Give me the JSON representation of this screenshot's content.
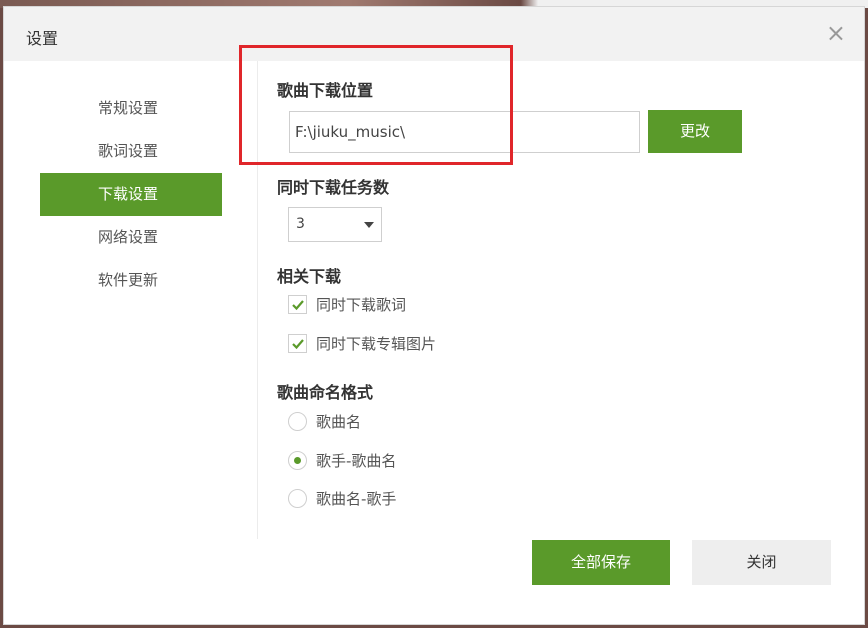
{
  "dialog": {
    "title": "设置",
    "close_icon": "close-icon",
    "close_glyph": "×"
  },
  "sidebar": {
    "items": [
      {
        "label": "常规设置",
        "active": false
      },
      {
        "label": "歌词设置",
        "active": false
      },
      {
        "label": "下载设置",
        "active": true
      },
      {
        "label": "网络设置",
        "active": false
      },
      {
        "label": "软件更新",
        "active": false
      }
    ]
  },
  "download_location": {
    "title": "歌曲下载位置",
    "path_value": "F:\\jiuku_music\\",
    "change_label": "更改"
  },
  "concurrent_tasks": {
    "title": "同时下载任务数",
    "selected": "3"
  },
  "related_downloads": {
    "title": "相关下载",
    "options": [
      {
        "label": "同时下载歌词",
        "checked": true
      },
      {
        "label": "同时下载专辑图片",
        "checked": true
      }
    ]
  },
  "naming_format": {
    "title": "歌曲命名格式",
    "options": [
      {
        "label": "歌曲名",
        "selected": false
      },
      {
        "label": "歌手-歌曲名",
        "selected": true
      },
      {
        "label": "歌曲名-歌手",
        "selected": false
      }
    ]
  },
  "footer": {
    "save_label": "全部保存",
    "close_label": "关闭"
  },
  "colors": {
    "accent": "#5a9a2a",
    "highlight": "#e0262a"
  }
}
